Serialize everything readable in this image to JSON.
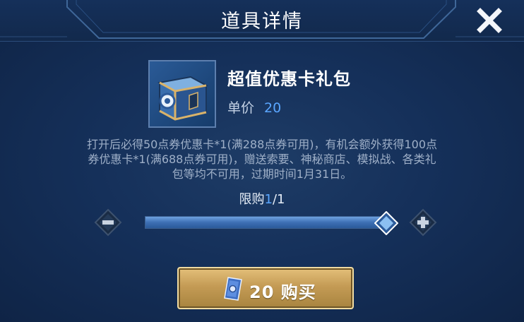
{
  "header": {
    "title": "道具详情"
  },
  "item": {
    "name": "超值优惠卡礼包",
    "price_label": "单价",
    "price_value": "20",
    "icon": "gift-box-icon",
    "description_lines": [
      "打开后必得50点券优惠卡*1(满288点券可用)，有机会额外获得100点",
      "券优惠卡*1(满688点券可用)，赠送索要、神秘商店、模拟战、各类礼",
      "包等均不可用，过期时间1月31日。"
    ]
  },
  "purchase_limit": {
    "label": "限购",
    "current": "1",
    "separator": "/",
    "max": "1"
  },
  "quantity_slider": {
    "value": 1,
    "min": 1,
    "max": 1,
    "fill_fraction": 1.0
  },
  "buy_button": {
    "label": "20 购买",
    "icon": "coupon-card-icon"
  },
  "icons": {
    "close": "close-icon",
    "minus": "minus-icon",
    "plus": "plus-icon",
    "thumb": "slider-thumb-diamond"
  },
  "colors": {
    "accent_blue": "#5aa6ff",
    "button_gold": "#c49b55",
    "background": "#15305a"
  }
}
